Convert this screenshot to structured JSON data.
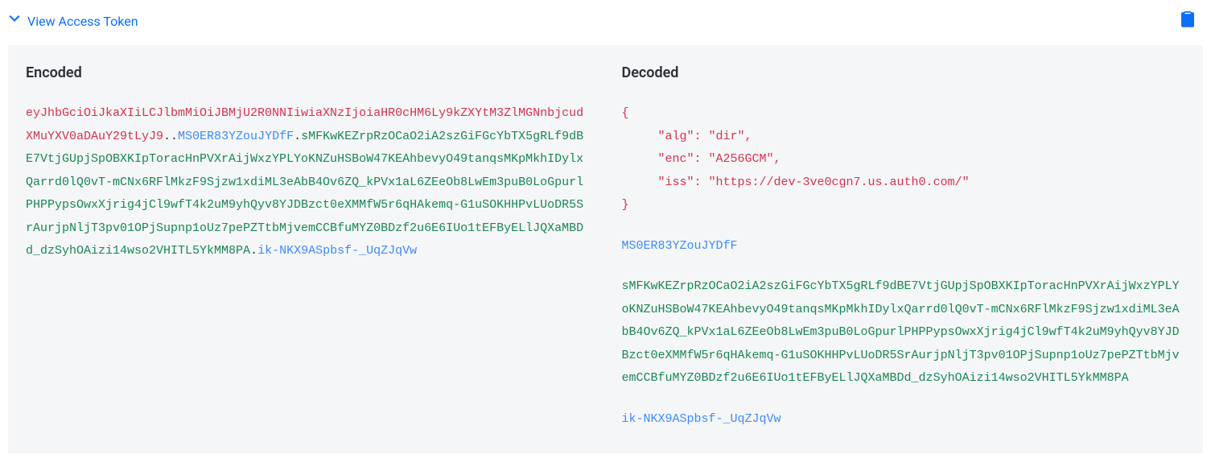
{
  "header": {
    "toggle_label": "View Access Token"
  },
  "panel": {
    "encoded_heading": "Encoded",
    "decoded_heading": "Decoded"
  },
  "jwt": {
    "part1": "eyJhbGciOiJkaXIiLCJlbmMiOiJBMjU2R0NNIiwiaXNzIjoiaHR0cHM6Ly9kZXYtM3ZlMGNnbjcudXMuYXV0aDAuY29tLyJ9",
    "part2": "MS0ER83YZouJYDfF",
    "part3": "sMFKwKEZrpRzOCaO2iA2szGiFGcYbTX5gRLf9dBE7VtjGUpjSpOBXKIpToracHnPVXrAijWxzYPLYoKNZuHSBoW47KEAhbevyO49tanqsMKpMkhIDylxQarrd0lQ0vT-mCNx6RFlMkzF9Sjzw1xdiML3eAbB4Ov6ZQ_kPVx1aL6ZEeOb8LwEm3puB0LoGpurlPHPPypsOwxXjrig4jCl9wfT4k2uM9yhQyv8YJDBzct0eXMMfW5r6qHAkemq-G1uSOKHHPvLUoDR5SrAurjpNljT3pv01OPjSupnp1oUz7pePZTtbMjvemCCBfuMYZ0BDzf2u6E6IUo1tEFByELlJQXaMBDd_dzSyhOAizi14wso2VHITL5YkMM8PA",
    "part4": "ik-NKX9ASpbsf-_UqZJqVw",
    "dot": ".",
    "dotdot": ".."
  },
  "decoded": {
    "json_text": "{\n     \"alg\": \"dir\",\n     \"enc\": \"A256GCM\",\n     \"iss\": \"https://dev-3ve0cgn7.us.auth0.com/\"\n}",
    "p2": "MS0ER83YZouJYDfF",
    "p3": "sMFKwKEZrpRzOCaO2iA2szGiFGcYbTX5gRLf9dBE7VtjGUpjSpOBXKIpToracHnPVXrAijWxzYPLYoKNZuHSBoW47KEAhbevyO49tanqsMKpMkhIDylxQarrd0lQ0vT-mCNx6RFlMkzF9Sjzw1xdiML3eAbB4Ov6ZQ_kPVx1aL6ZEeOb8LwEm3puB0LoGpurlPHPPypsOwxXjrig4jCl9wfT4k2uM9yhQyv8YJDBzct0eXMMfW5r6qHAkemq-G1uSOKHHPvLUoDR5SrAurjpNljT3pv01OPjSupnp1oUz7pePZTtbMjvemCCBfuMYZ0BDzf2u6E6IUo1tEFByELlJQXaMBDd_dzSyhOAizi14wso2VHITL5YkMM8PA",
    "p4": "ik-NKX9ASpbsf-_UqZJqVw"
  }
}
